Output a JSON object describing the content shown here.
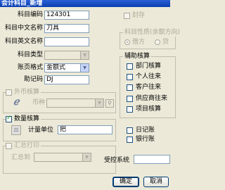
{
  "window": {
    "title": "会计科目_新增"
  },
  "form": {
    "code_label": "科目编码",
    "code_value": "124301",
    "cn_name_label": "科目中文名称",
    "cn_name_value": "刀具",
    "en_name_label": "科目英文名称",
    "en_name_value": "",
    "type_label": "科目类型",
    "type_value": "",
    "format_label": "账页格式",
    "format_value": "金额式",
    "mnemonic_label": "助记码",
    "mnemonic_value": "DJ"
  },
  "right": {
    "sealed_label": "封存",
    "nature_group": "科目性质(余额方向)",
    "debit_label": "借方",
    "credit_label": "贷",
    "aux_group": "辅助核算",
    "aux_items": [
      "部门核算",
      "个人往来",
      "客户往来",
      "供应商往来",
      "项目核算"
    ],
    "journal_label": "日记账",
    "bank_label": "银行账",
    "control_label": "受控系统",
    "control_value": ""
  },
  "foreign": {
    "group": "外币核算",
    "currency_label": "币种",
    "currency_value": ""
  },
  "quantity": {
    "group": "数量核算",
    "unit_label": "计量单位",
    "unit_value": "把"
  },
  "summary": {
    "group": "汇总打印",
    "to_label": "汇总到",
    "to_value": ""
  },
  "buttons": {
    "ok": "确定",
    "cancel": "取消"
  }
}
